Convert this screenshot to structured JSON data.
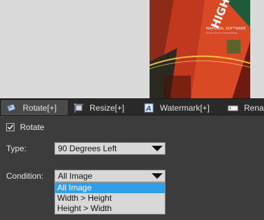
{
  "preview": {
    "logo_line1": "MAPERIAL SOFTWARE",
    "logo_line2": "IMAGE BATCH PROCESSING"
  },
  "tabs": [
    {
      "label": "Rotate[+]",
      "icon": "rotate-icon"
    },
    {
      "label": "Resize[+]",
      "icon": "resize-icon"
    },
    {
      "label": "Watermark[+]",
      "icon": "watermark-icon"
    },
    {
      "label": "Rena",
      "icon": "rename-icon"
    }
  ],
  "rotate": {
    "checkbox_label": "Rotate",
    "checked": true
  },
  "type_field": {
    "label": "Type:",
    "value": "90 Degrees Left"
  },
  "condition_field": {
    "label": "Condition:",
    "value": "All Image",
    "options": [
      "All Image",
      "Width > Height",
      "Height > Width"
    ],
    "highlighted_option": "All Image"
  },
  "colors": {
    "panel_bg": "#3c3c3c",
    "tab_bar_bg": "#2a2a2a",
    "highlight": "#2f9fea"
  }
}
